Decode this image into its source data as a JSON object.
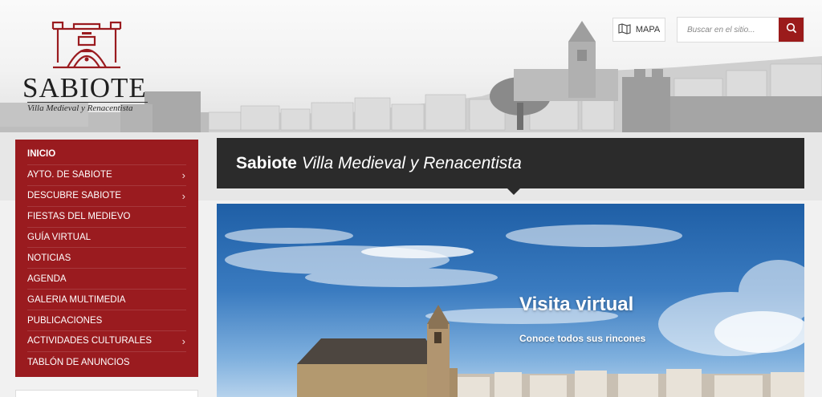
{
  "logo": {
    "word": "SABIOTE",
    "tagline": "Villa Medieval y Renacentista"
  },
  "header": {
    "map_label": "MAPA",
    "search_placeholder": "Buscar en el sitio..."
  },
  "nav": {
    "items": [
      {
        "label": "INICIO",
        "submenu": false,
        "active": true
      },
      {
        "label": "AYTO. DE SABIOTE",
        "submenu": true
      },
      {
        "label": "DESCUBRE SABIOTE",
        "submenu": true
      },
      {
        "label": "FIESTAS DEL MEDIEVO",
        "submenu": false
      },
      {
        "label": "GUÍA VIRTUAL",
        "submenu": false
      },
      {
        "label": "NOTICIAS",
        "submenu": false
      },
      {
        "label": "AGENDA",
        "submenu": false
      },
      {
        "label": "GALERIA MULTIMEDIA",
        "submenu": false
      },
      {
        "label": "PUBLICACIONES",
        "submenu": false
      },
      {
        "label": "ACTIVIDADES CULTURALES",
        "submenu": true
      },
      {
        "label": "TABLÓN DE ANUNCIOS",
        "submenu": false
      }
    ],
    "chevron": "›"
  },
  "titlebar": {
    "strong": "Sabiote",
    "em": "Villa Medieval y Renacentista"
  },
  "hero": {
    "title": "Visita virtual",
    "subtitle": "Conoce todos sus rincones"
  },
  "colors": {
    "brand_red": "#9a1b1f",
    "title_bar": "#2b2b2b",
    "sky": "#3a7bc0"
  },
  "icons": {
    "map": "map-icon",
    "search": "search-icon",
    "logo": "castle-logo-icon"
  }
}
